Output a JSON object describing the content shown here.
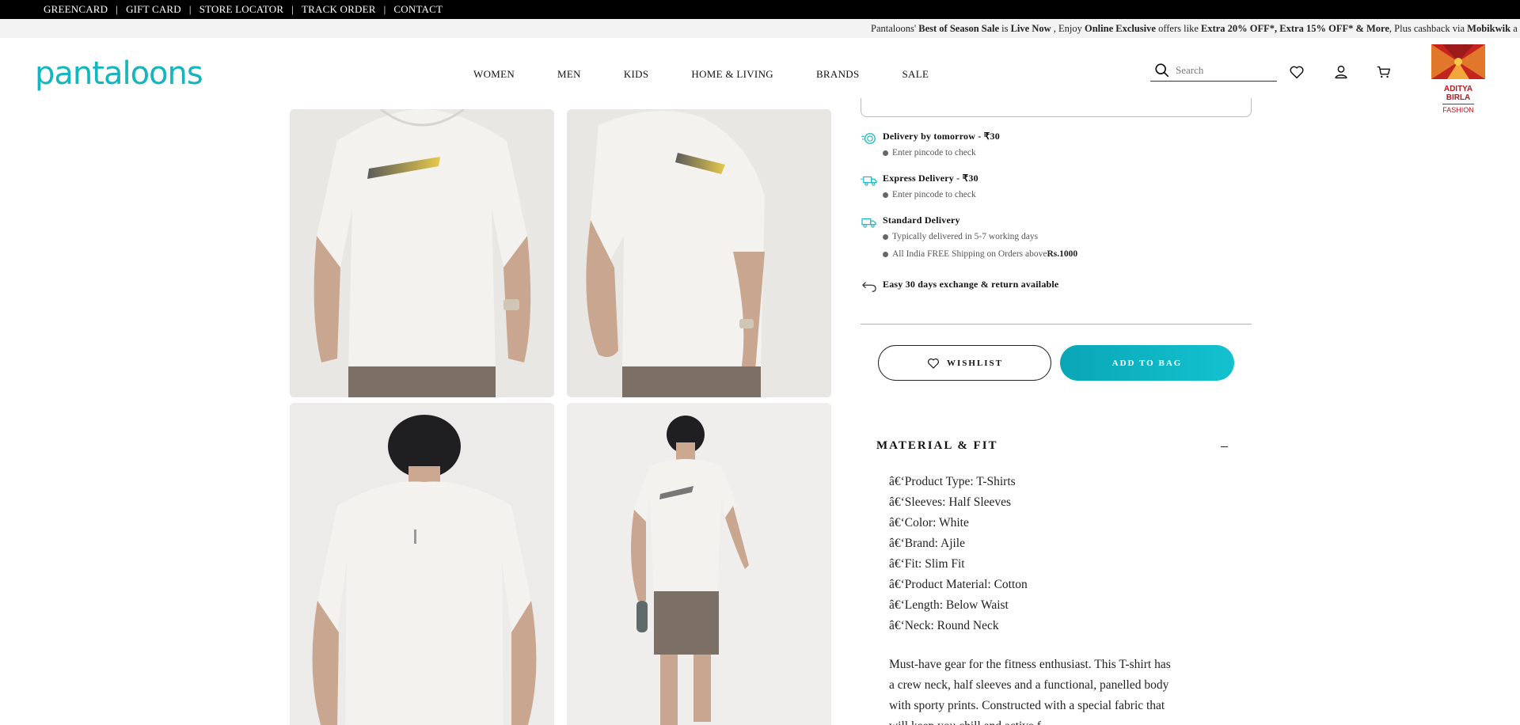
{
  "utility_bar": {
    "links": [
      "GREENCARD",
      "GIFT CARD",
      "STORE LOCATOR",
      "TRACK ORDER",
      "CONTACT"
    ],
    "separator": "|"
  },
  "promo": {
    "p1": "Pantaloons' ",
    "b1": "Best of Season Sale",
    "p2": " is ",
    "b2": "Live Now",
    "p3": " , Enjoy ",
    "b3": "Online Exclusive",
    "p4": " offers like ",
    "b4": "Extra 20% OFF*, Extra 15% OFF* & More",
    "p5": ", Plus cashback via ",
    "b5": "Mobikwik",
    "p6": " a"
  },
  "header": {
    "logo": "pantaloons",
    "nav": [
      "WOMEN",
      "MEN",
      "KIDS",
      "HOME & LIVING",
      "BRANDS",
      "SALE"
    ],
    "search_placeholder": "Search",
    "badge_line1": "ADITYA BIRLA",
    "badge_line2": "FASHION"
  },
  "delivery": {
    "tomorrow_title": "Delivery by tomorrow - ₹30",
    "tomorrow_note": "Enter pincode to check",
    "express_title": "Express Delivery - ₹30",
    "express_note": "Enter pincode to check",
    "standard_title": "Standard Delivery",
    "standard_note1": "Typically delivered in 5-7 working days",
    "standard_note2_text": "All India FREE Shipping on Orders above ",
    "standard_note2_bold": "Rs.1000",
    "exchange": "Easy 30 days exchange & return available"
  },
  "actions": {
    "wishlist": "WISHLIST",
    "add_to_bag": "ADD TO BAG"
  },
  "material_fit": {
    "title": "MATERIAL & FIT",
    "toggle": "–",
    "specs": [
      "â€‘Product Type: T-Shirts",
      "â€‘Sleeves: Half Sleeves",
      "â€‘Color: White",
      "â€‘Brand: Ajile",
      "â€‘Fit: Slim Fit",
      "â€‘Product Material: Cotton",
      "â€‘Length: Below Waist",
      "â€‘Neck: Round Neck"
    ],
    "description": "Must-have gear for the fitness enthusiast. This T-shirt has a crew neck, half sleeves and a functional, panelled body with sporty prints. Constructed with a special fabric that will keep you chill and active f"
  },
  "colors": {
    "brand_teal": "#13b5bf",
    "gold_divider": "#e5b11c",
    "aditya_red": "#b01e23"
  }
}
